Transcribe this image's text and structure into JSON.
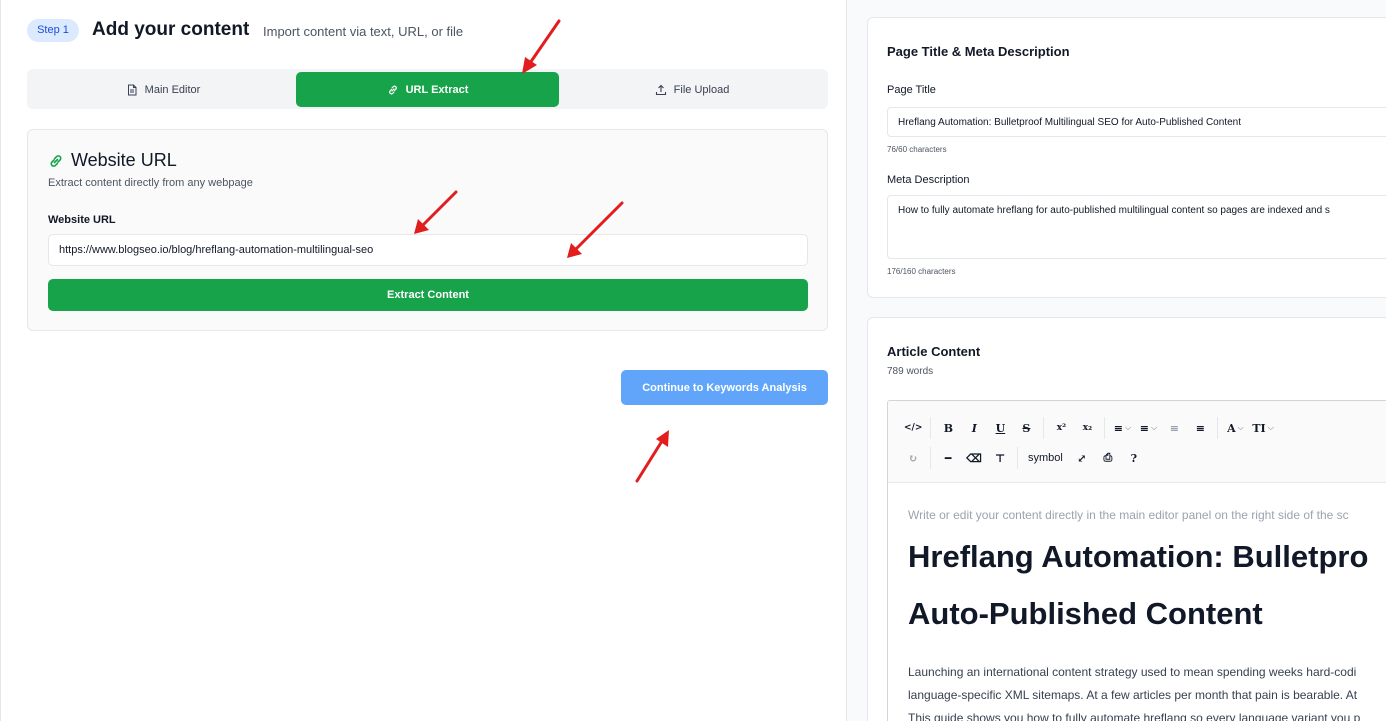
{
  "left": {
    "step_badge": "Step 1",
    "title": "Add your content",
    "subtitle": "Import content via text, URL, or file",
    "tabs": [
      {
        "label": "Main Editor",
        "icon": "document-icon",
        "active": false
      },
      {
        "label": "URL Extract",
        "icon": "link-icon",
        "active": true
      },
      {
        "label": "File Upload",
        "icon": "upload-icon",
        "active": false
      }
    ],
    "card": {
      "title": "Website URL",
      "description": "Extract content directly from any webpage",
      "field_label": "Website URL",
      "url_value": "https://www.blogseo.io/blog/hreflang-automation-multilingual-seo",
      "extract_button": "Extract Content"
    },
    "continue_button": "Continue to Keywords Analysis"
  },
  "right": {
    "meta": {
      "title": "Page Title & Meta Description",
      "page_title_label": "Page Title",
      "page_title_value": "Hreflang Automation: Bulletproof Multilingual SEO for Auto-Published Content",
      "page_title_count": "76/60 characters",
      "meta_label": "Meta Description",
      "meta_value": "How to fully automate hreflang for auto-published multilingual content so pages are indexed and s",
      "meta_count": "176/160 characters"
    },
    "article": {
      "title": "Article Content",
      "word_count": "789 words",
      "toolbar_row1": [
        "</>",
        "B",
        "I",
        "U",
        "S",
        "x²",
        "x₂",
        "≡",
        "≡",
        "≡",
        "≡",
        "A",
        "TI"
      ],
      "toolbar_symbol": "symbol",
      "placeholder": "Write or edit your content directly in the main editor panel on the right side of the sc",
      "heading_line1": "Hreflang Automation: Bulletpro",
      "heading_line2": "Auto-Published Content",
      "para_line1": "Launching an international content strategy used to mean spending weeks hard-codi",
      "para_line2": "language-specific XML sitemaps. At a few articles per month that pain is bearable. At",
      "para_line3": "This guide shows you how to fully automate hreflang so every language variant you p"
    }
  },
  "colors": {
    "accent_green": "#16a34a",
    "continue_blue": "#60a5fa",
    "annotation_red": "#e11d1d"
  }
}
